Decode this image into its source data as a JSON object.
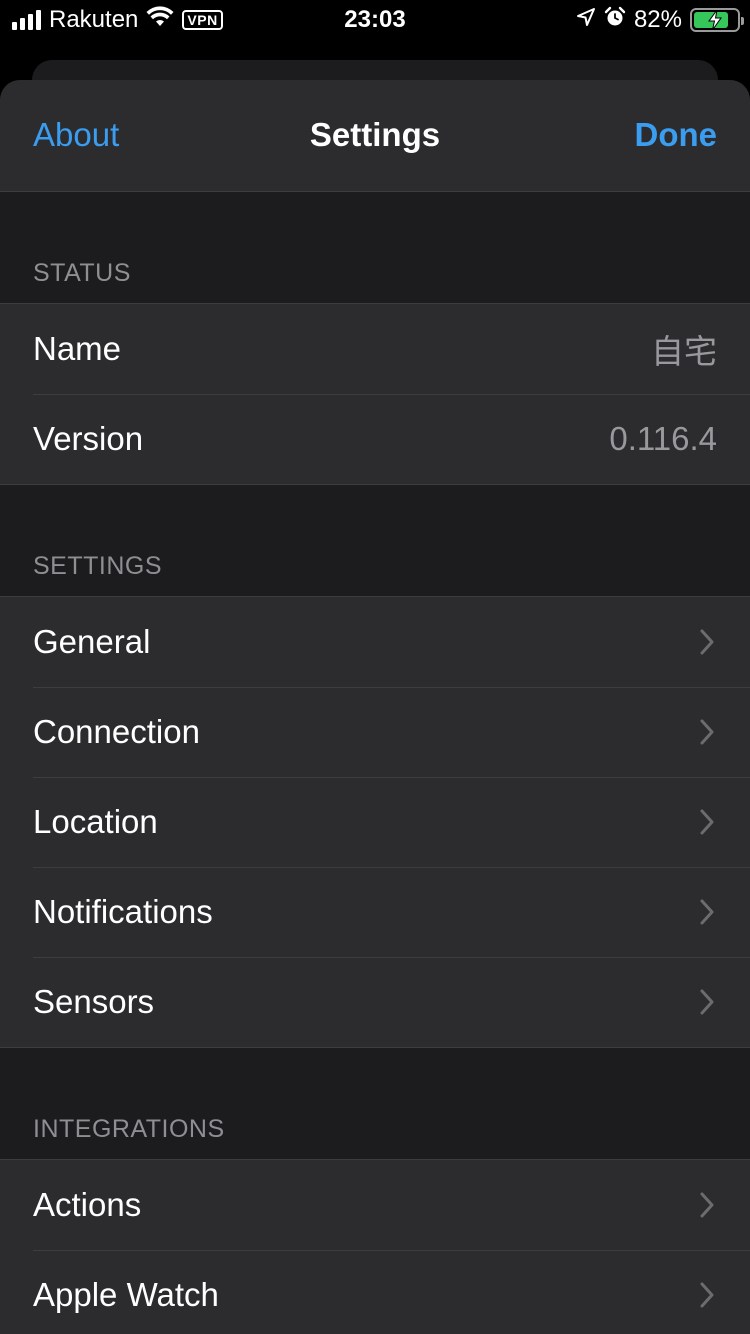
{
  "status_bar": {
    "carrier": "Rakuten",
    "vpn": "VPN",
    "time": "23:03",
    "battery_percent": "82%",
    "battery_level": 0.82,
    "icons": [
      "signal-icon",
      "wifi-icon",
      "vpn-icon",
      "location-arrow-icon",
      "alarm-icon",
      "battery-charging-icon"
    ]
  },
  "nav": {
    "left": "About",
    "title": "Settings",
    "right": "Done"
  },
  "sections": {
    "status": {
      "header": "STATUS",
      "rows": [
        {
          "label": "Name",
          "value": "自宅"
        },
        {
          "label": "Version",
          "value": "0.116.4"
        }
      ]
    },
    "settings": {
      "header": "SETTINGS",
      "rows": [
        {
          "label": "General"
        },
        {
          "label": "Connection"
        },
        {
          "label": "Location"
        },
        {
          "label": "Notifications"
        },
        {
          "label": "Sensors"
        }
      ]
    },
    "integrations": {
      "header": "INTEGRATIONS",
      "rows": [
        {
          "label": "Actions"
        },
        {
          "label": "Apple Watch"
        }
      ]
    }
  },
  "colors": {
    "accent": "#3a9df0",
    "background": "#1c1c1e",
    "cell": "#2c2c2e",
    "secondary_text": "#8e8e93",
    "battery_green": "#35c759"
  }
}
